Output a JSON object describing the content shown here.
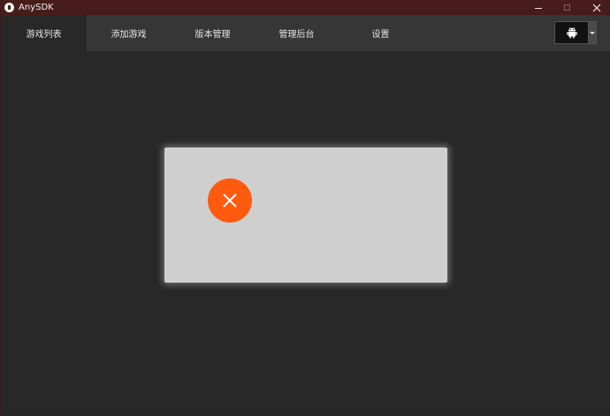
{
  "window": {
    "title": "AnySDK",
    "controls": {
      "minimize": "minimize",
      "maximize": "maximize",
      "close": "close"
    }
  },
  "nav": {
    "tabs": [
      {
        "label": "游戏列表",
        "active": true
      },
      {
        "label": "添加游戏",
        "active": false
      },
      {
        "label": "版本管理",
        "active": false
      },
      {
        "label": "管理后台",
        "active": false
      },
      {
        "label": "设置",
        "active": false
      }
    ],
    "platform": {
      "icon": "android-icon"
    }
  },
  "dialog": {
    "status_icon": "error-x-icon"
  },
  "colors": {
    "titlebar": "#471c1a",
    "navbar": "#363636",
    "background": "#282828",
    "dialog": "#cfcfcf",
    "error": "#ff5a0e"
  }
}
